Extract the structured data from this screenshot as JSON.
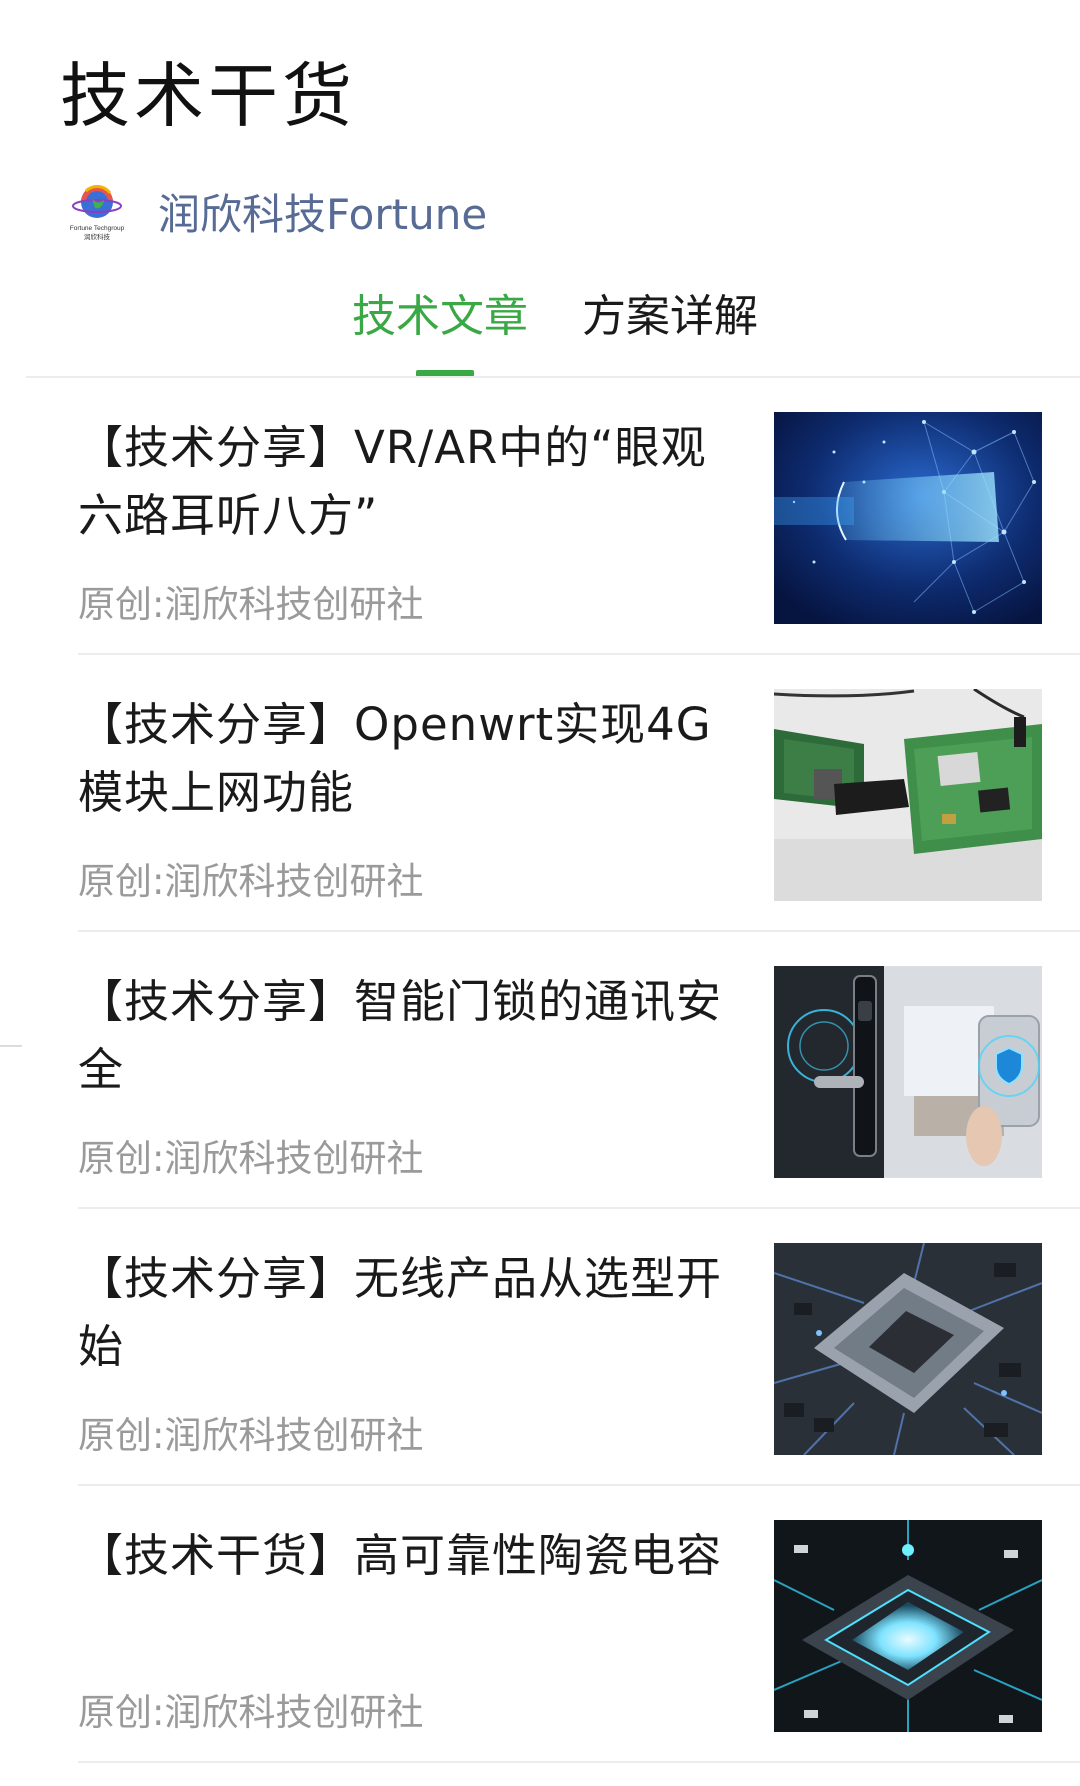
{
  "page": {
    "title": "技术干货"
  },
  "account": {
    "name": "润欣科技Fortune",
    "logo_text_line1": "Fortune Techgroup",
    "logo_text_line2": "润欣科技"
  },
  "tabs": [
    {
      "label": "技术文章",
      "active": true
    },
    {
      "label": "方案详解",
      "active": false
    }
  ],
  "colors": {
    "accent": "#3aa845",
    "account_name": "#576b95",
    "meta_text": "#9a9a9a"
  },
  "articles": [
    {
      "title": "【技术分享】VR/AR中的“眼观六路耳听八方”",
      "source": "原创:润欣科技创研社",
      "thumb_icon": "vr-headset-face-image"
    },
    {
      "title": "【技术分享】Openwrt实现4G模块上网功能",
      "source": "原创:润欣科技创研社",
      "thumb_icon": "circuit-board-photo"
    },
    {
      "title": "【技术分享】智能门锁的通讯安全",
      "source": "原创:润欣科技创研社",
      "thumb_icon": "smart-door-lock-image"
    },
    {
      "title": "【技术分享】无线产品从选型开始",
      "source": "原创:润欣科技创研社",
      "thumb_icon": "processor-chip-image"
    },
    {
      "title": "【技术干货】高可靠性陶瓷电容",
      "source": "原创:润欣科技创研社",
      "thumb_icon": "glowing-chip-image"
    }
  ]
}
